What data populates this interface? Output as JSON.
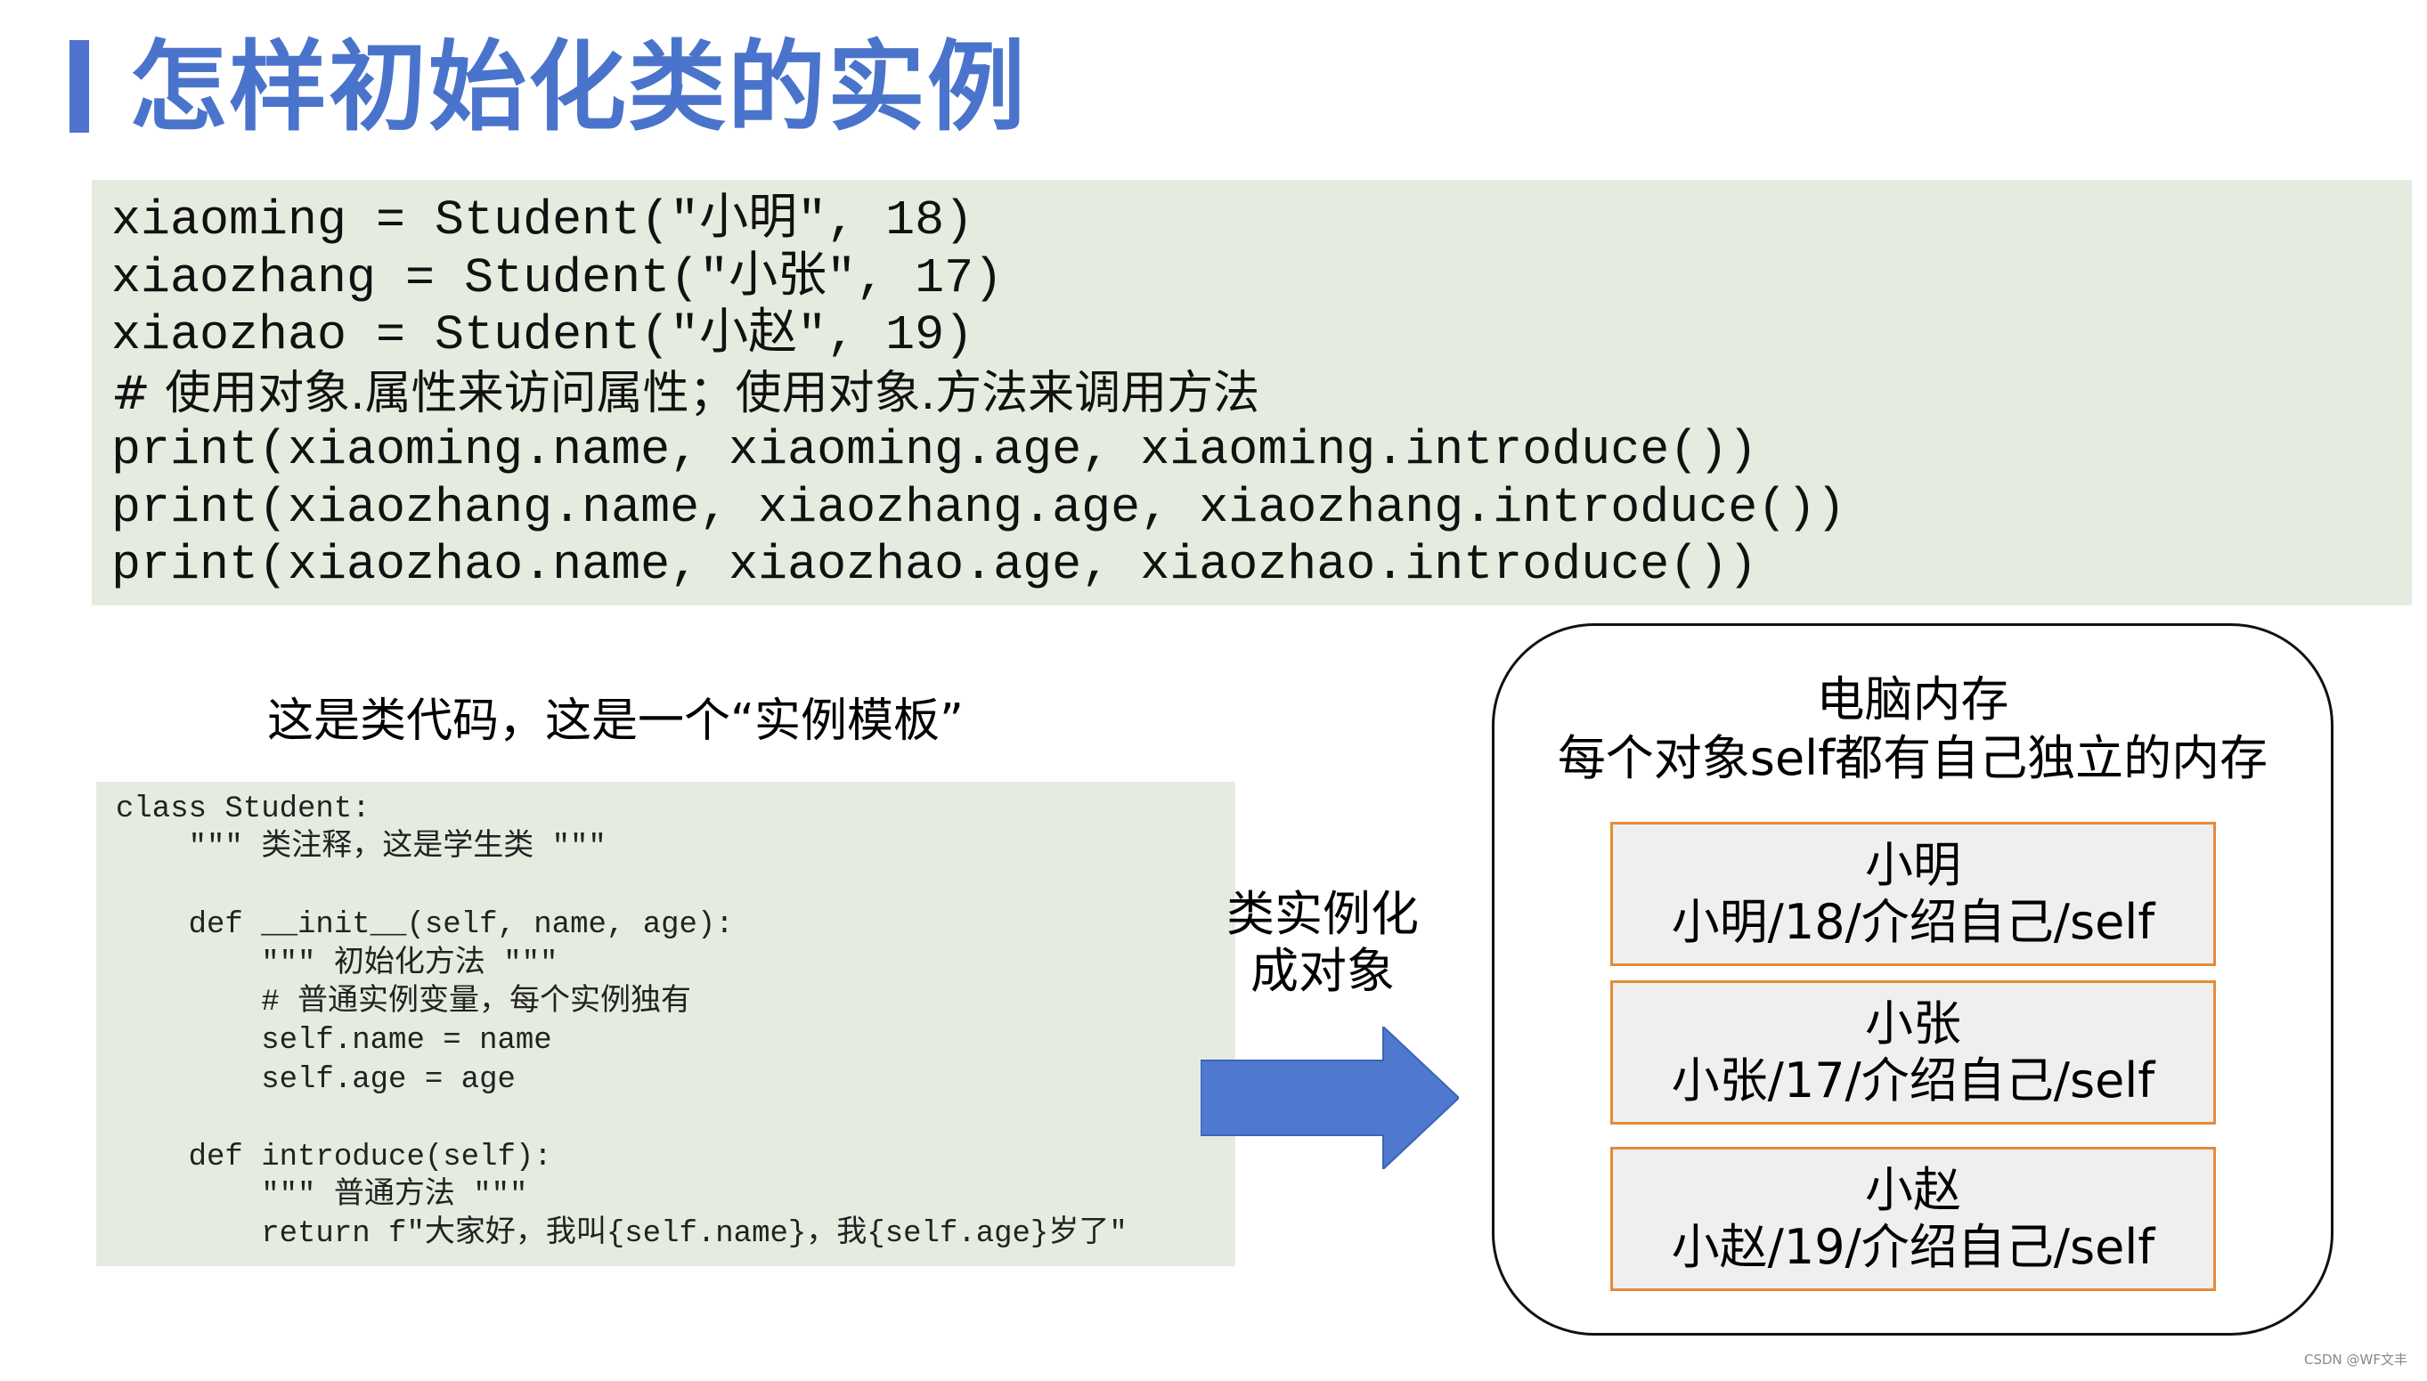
{
  "title": "怎样初始化类的实例",
  "code_top": [
    "xiaoming = Student(\"小明\", 18)",
    "xiaozhang = Student(\"小张\", 17)",
    "xiaozhao = Student(\"小赵\", 19)",
    "# 使用对象.属性来访问属性；使用对象.方法来调用方法",
    "print(xiaoming.name, xiaoming.age, xiaoming.introduce())",
    "print(xiaozhang.name, xiaozhang.age, xiaozhang.introduce())",
    "print(xiaozhao.name, xiaozhao.age, xiaozhao.introduce())"
  ],
  "template_label": "这是类代码，这是一个“实例模板”",
  "code_class": [
    "class Student:",
    "    \"\"\" 类注释，这是学生类 \"\"\"",
    "",
    "    def __init__(self, name, age):",
    "        \"\"\" 初始化方法 \"\"\"",
    "        # 普通实例变量，每个实例独有",
    "        self.name = name",
    "        self.age = age",
    "",
    "    def introduce(self):",
    "        \"\"\" 普通方法 \"\"\"",
    "        return f\"大家好，我叫{self.name}，我{self.age}岁了\""
  ],
  "arrow_label": {
    "line1": "类实例化",
    "line2": "成对象"
  },
  "memory": {
    "title1": "电脑内存",
    "title2": "每个对象self都有自己独立的内存",
    "objects": [
      {
        "name": "小明",
        "detail": "小明/18/介绍自己/self"
      },
      {
        "name": "小张",
        "detail": "小张/17/介绍自己/self"
      },
      {
        "name": "小赵",
        "detail": "小赵/19/介绍自己/self"
      }
    ]
  },
  "watermark": "CSDN @WF文丰",
  "colors": {
    "title": "#4a74cc",
    "code_bg": "#e5ecdf",
    "arrow": "#4f78cf",
    "object_border": "#e58a38",
    "object_bg": "#efefef"
  }
}
